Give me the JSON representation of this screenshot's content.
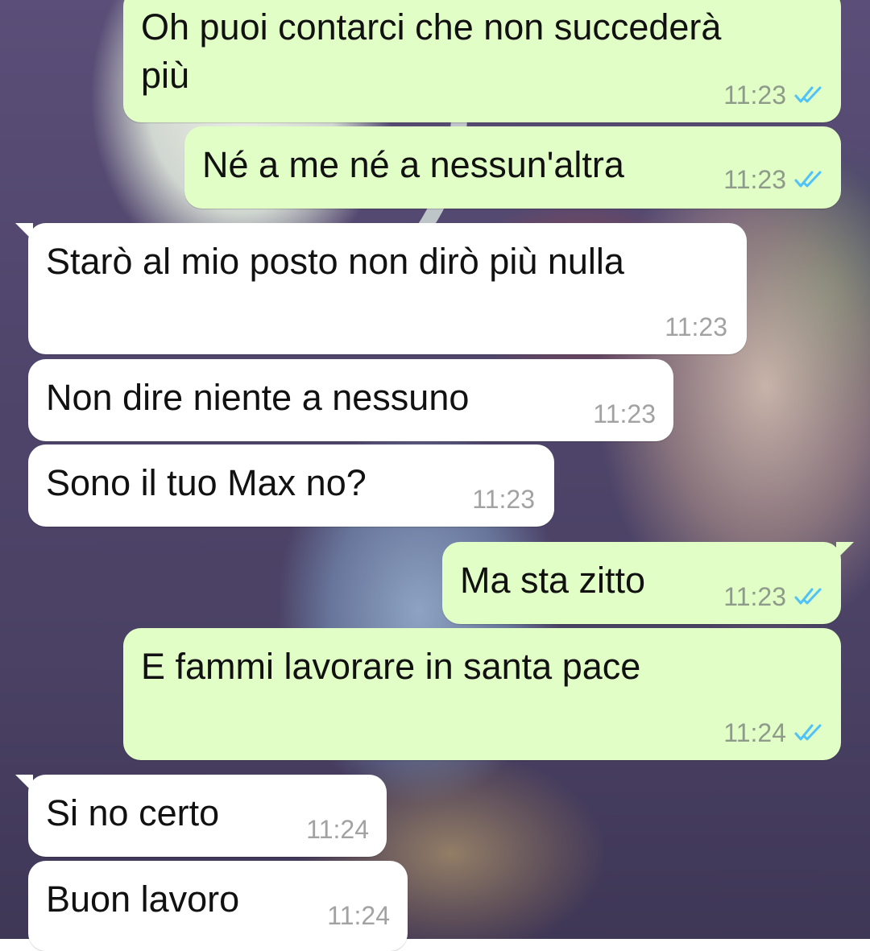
{
  "colors": {
    "outgoing_bubble": "#e1fec6",
    "incoming_bubble": "#ffffff",
    "read_tick": "#4fc3f7",
    "timestamp_outgoing": "#8e9a8a",
    "timestamp_incoming": "#a2a2a2"
  },
  "messages": [
    {
      "direction": "outgoing",
      "text_line1": "Oh puoi contarci che non succederà",
      "text_line2": "più",
      "time": "11:23",
      "status_icon": "double-check-read-icon"
    },
    {
      "direction": "outgoing",
      "text": "Né a me né a nessun'altra",
      "time": "11:23",
      "status_icon": "double-check-read-icon"
    },
    {
      "direction": "incoming",
      "text": "Starò al mio posto non dirò più nulla",
      "time": "11:23"
    },
    {
      "direction": "incoming",
      "text": "Non dire niente a nessuno",
      "time": "11:23"
    },
    {
      "direction": "incoming",
      "text": "Sono il tuo Max no?",
      "time": "11:23"
    },
    {
      "direction": "outgoing",
      "text": "Ma sta zitto",
      "time": "11:23",
      "status_icon": "double-check-read-icon"
    },
    {
      "direction": "outgoing",
      "text": "E fammi lavorare in santa pace",
      "time": "11:24",
      "status_icon": "double-check-read-icon"
    },
    {
      "direction": "incoming",
      "text": "Si no certo",
      "time": "11:24"
    },
    {
      "direction": "incoming",
      "text": "Buon lavoro",
      "time": "11:24"
    }
  ]
}
